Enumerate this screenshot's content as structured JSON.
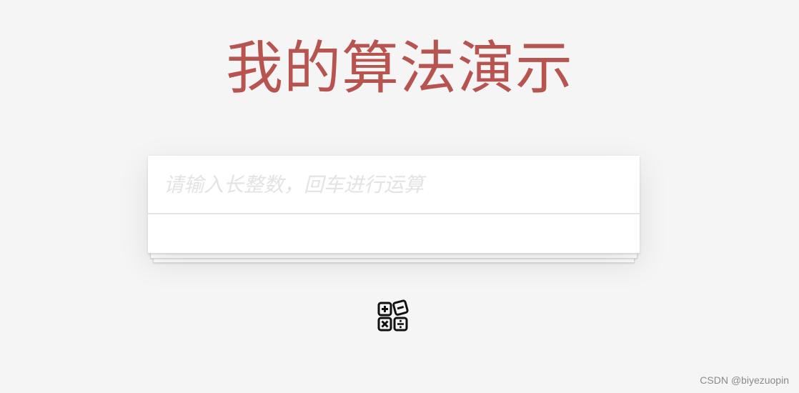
{
  "header": {
    "title": "我的算法演示"
  },
  "input": {
    "placeholder": "请输入长整数，回车进行运算",
    "value": ""
  },
  "result": {
    "text": ""
  },
  "footer": {
    "icon": "calculator-icon"
  },
  "watermark": {
    "text": "CSDN @biyezuopin"
  },
  "colors": {
    "title": "#b85450",
    "background": "#f5f5f5",
    "card": "#ffffff"
  }
}
